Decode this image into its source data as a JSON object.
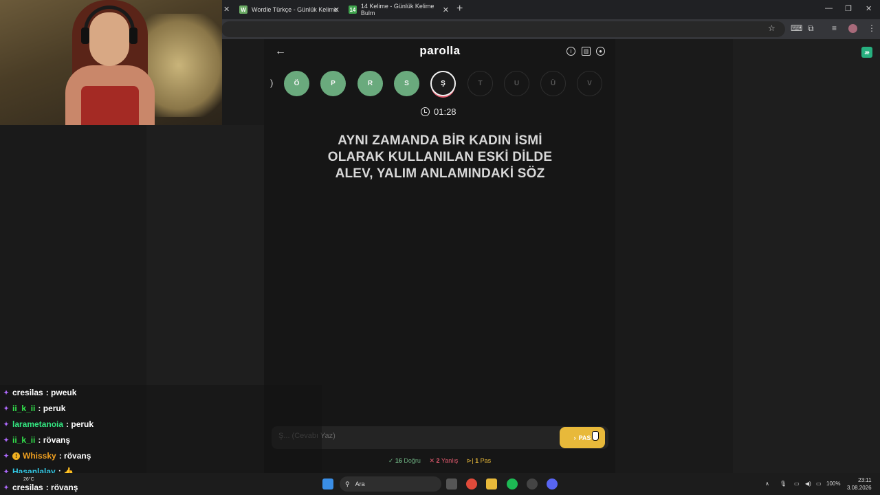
{
  "browser": {
    "tabs": [
      {
        "label": "Wordle Türkçe - Günlük Kelime",
        "icon": "W",
        "color": "#6aaa64"
      },
      {
        "label": "14 Kelime - Günlük Kelime Bulm",
        "icon": "14",
        "color": "#3fa34d"
      }
    ]
  },
  "game": {
    "title": "parolla",
    "partial_letter": ")",
    "letters": [
      {
        "char": "Ö",
        "state": "done"
      },
      {
        "char": "P",
        "state": "done"
      },
      {
        "char": "R",
        "state": "done"
      },
      {
        "char": "S",
        "state": "done"
      },
      {
        "char": "Ş",
        "state": "active"
      },
      {
        "char": "T",
        "state": "todo"
      },
      {
        "char": "U",
        "state": "todo"
      },
      {
        "char": "Ü",
        "state": "todo"
      },
      {
        "char": "V",
        "state": "todo"
      }
    ],
    "timer": "01:28",
    "question_lines": [
      "AYNI ZAMANDA BİR KADIN İSMİ",
      "OLARAK KULLANILAN ESKİ DİLDE",
      "ALEV, YALIM ANLAMINDAKİ SÖZ"
    ],
    "answer_placeholder": "Ş... (Cevabı Yaz)",
    "pass_label": "PAS",
    "stats": {
      "correct_count": "16",
      "correct_label": "Doğru",
      "wrong_count": "2",
      "wrong_label": "Yanlış",
      "pass_count": "1",
      "pass_label": "Pas"
    }
  },
  "chat": [
    {
      "user": "cresilas",
      "msg": ": pweuk",
      "color": "#ffffff"
    },
    {
      "user": "ii_k_ii",
      "msg": ": peruk",
      "color": "#33e64d"
    },
    {
      "user": "larametanoia",
      "msg": ": peruk",
      "color": "#33e680"
    },
    {
      "user": "ii_k_ii",
      "msg": ": rövanş",
      "color": "#33e64d"
    },
    {
      "user": "Whissky",
      "msg": ": rövanş",
      "color": "#f0a020"
    },
    {
      "user": "Hasanlalay",
      "msg": ": 👍",
      "color": "#33c9e6"
    },
    {
      "user": "cresilas",
      "msg": ": rövanş",
      "color": "#ffffff"
    }
  ],
  "taskbar": {
    "search_label": "Ara",
    "weather": "26°C",
    "battery": "100%",
    "time": "23:11",
    "date": "3.08.2026"
  },
  "colors": {
    "correct": "#6aaa7d",
    "active_ring": "#e35b6e",
    "pass": "#e8b93a"
  }
}
